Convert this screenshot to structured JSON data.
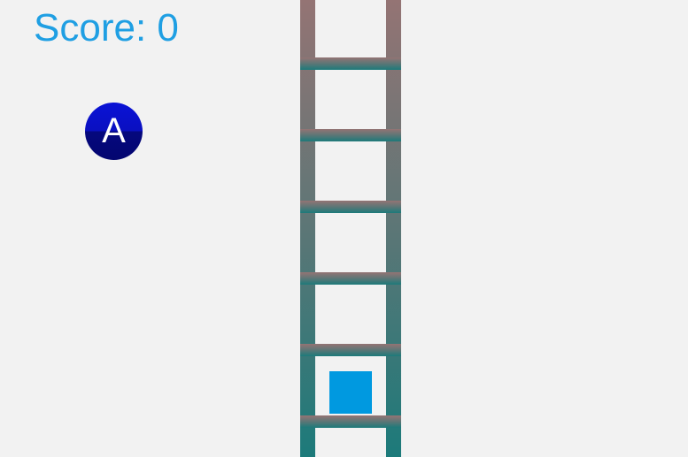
{
  "hud": {
    "score_label": "Score:",
    "score_value": "0"
  },
  "controls": {
    "action_button_label": "A"
  },
  "colors": {
    "background": "#f2f2f2",
    "score_text": "#1f9fe3",
    "action_button_top": "#0a12d6",
    "action_button_bottom": "#05087e",
    "player": "#0099e0",
    "ladder_top": "#8e7a7a",
    "ladder_bottom": "#1e7a7a"
  },
  "icons": {
    "ladder": "ladder-icon",
    "player": "player-block-icon"
  }
}
